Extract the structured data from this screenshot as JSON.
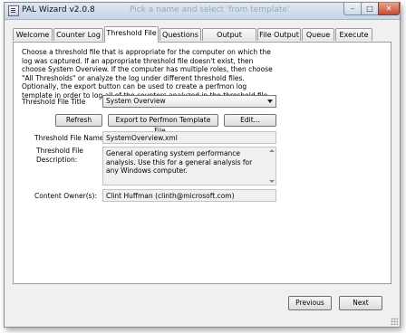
{
  "window": {
    "title": "PAL Wizard v2.0.8",
    "ghost_title": "Pick a name and select 'from template'",
    "controls": {
      "minimize": "–",
      "maximize": "□",
      "close": "✕"
    }
  },
  "tabs": [
    {
      "label": "Welcome"
    },
    {
      "label": "Counter Log"
    },
    {
      "label": "Threshold File",
      "active": true
    },
    {
      "label": "Questions"
    },
    {
      "label": "Output Options"
    },
    {
      "label": "File Output"
    },
    {
      "label": "Queue"
    },
    {
      "label": "Execute"
    }
  ],
  "threshold": {
    "description": "Choose a threshold file that is appropriate for the computer on which the log was captured. If an appropriate threshold file doesn't exist, then choose System Overview. If the computer has multiple roles, then choose \"All Thresholds\" or analyze the log under different threshold files. Optionally, the export button can be used to create a perfmon log template in order to log all of the counters analyzed in the threshold file.",
    "title_label": "Threshold File Title",
    "title_value": "System Overview",
    "refresh_button": "Refresh",
    "export_button": "Export to Perfmon Template File...",
    "edit_button": "Edit...",
    "file_name_label": "Threshold File Name:",
    "file_name_value": "SystemOverview.xml",
    "file_desc_label_1": "Threshold File",
    "file_desc_label_2": "Description:",
    "file_desc_value": "General operating system performance analysis. Use this for a general analysis for any Windows computer.",
    "owner_label": "Content Owner(s):",
    "owner_value": "Clint Huffman (clinth@microsoft.com)"
  },
  "nav": {
    "previous_button": "Previous",
    "next_button": "Next"
  }
}
